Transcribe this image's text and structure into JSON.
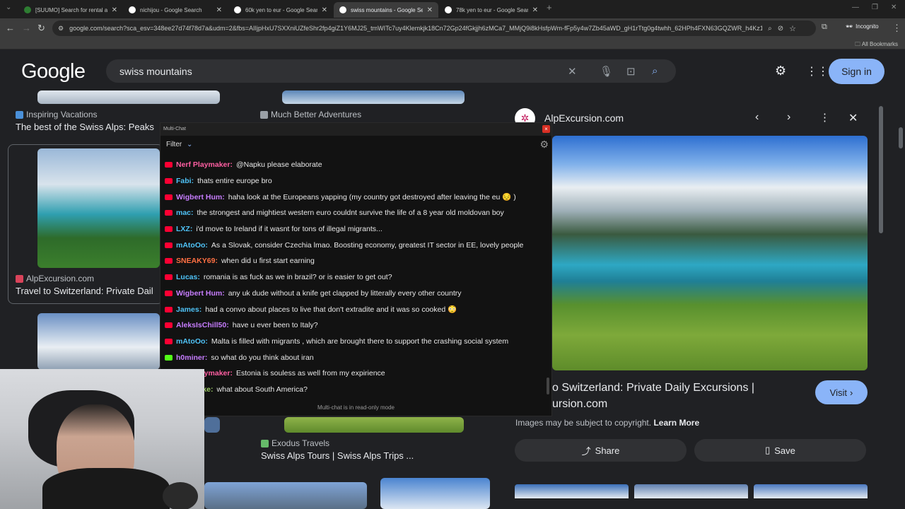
{
  "tabs": [
    {
      "title": "[SUUMO] Search for rental apa",
      "active": false
    },
    {
      "title": "nichijou - Google Search",
      "active": false
    },
    {
      "title": "60k yen to eur - Google Search",
      "active": false
    },
    {
      "title": "swiss mountains - Google Sear",
      "active": true
    },
    {
      "title": "78k yen to eur - Google Search",
      "active": false
    }
  ],
  "toolbar": {
    "url": "google.com/search?sca_esv=348ee27d74f78d7a&udm=2&fbs=AIIjpHxU7SXXniUZfeShr2fp4giZ1Y6MJ25_tmWITc7uy4Klemkjk18Cn72Gp24fGkjjh6zMCa7_MMjQ9i8kHsfpWm-fFp5y4w7Zb45aWD_gH1rTtg0g4twhh_62HPh4FXN63GQZWR_h4Kz1W9-IDHxqw...",
    "incognito_label": "Incognito",
    "all_bookmarks": "All Bookmarks"
  },
  "search": {
    "logo": "Google",
    "query": "swiss mountains",
    "sign_in": "Sign in"
  },
  "results": [
    {
      "source": "Inspiring Vacations",
      "title": "The best of the Swiss Alps: Peaks"
    },
    {
      "source": "Much Better Adventures",
      "title": ""
    },
    {
      "source": "AlpExcursion.com",
      "title": "Travel to Switzerland: Private Dail"
    },
    {
      "source": "Exodus Travels",
      "title": "Swiss Alps Tours | Swiss Alps Trips ..."
    }
  ],
  "panel": {
    "source": "AlpExcursion.com",
    "title_line1": "o Switzerland: Private Daily Excursions |",
    "title_line2": "ursion.com",
    "visit": "Visit",
    "copyright": "Images may be subject to copyright.",
    "learn_more": "Learn More",
    "share": "Share",
    "save": "Save"
  },
  "chat": {
    "title": "Multi-Chat",
    "filter": "Filter",
    "readonly": "Multi-chat is in read-only mode",
    "messages": [
      {
        "platform": "youtube",
        "user": "Nerf Playmaker:",
        "color": "#ff5fa2",
        "text": "@Napku please elaborate"
      },
      {
        "platform": "youtube",
        "user": "Fabi:",
        "color": "#4fc3f7",
        "text": "thats entire europe bro"
      },
      {
        "platform": "youtube",
        "user": "Wigbert Hum:",
        "color": "#c77dff",
        "text": "haha look at the Europeans yapping (my country got destroyed after leaving the eu 😔 )"
      },
      {
        "platform": "youtube",
        "user": "mac:",
        "color": "#4fc3f7",
        "text": "the strongest and mightiest western euro couldnt survive the life of a 8 year old moldovan boy"
      },
      {
        "platform": "youtube",
        "user": "LXZ:",
        "color": "#4fc3f7",
        "text": "i'd move to Ireland if it wasnt for tons of illegal migrants..."
      },
      {
        "platform": "youtube",
        "user": "mAtoOo:",
        "color": "#4fc3f7",
        "text": "As a Slovak, consider Czechia lmao. Boosting economy, greatest IT sector in EE, lovely people"
      },
      {
        "platform": "youtube",
        "user": "SNEAKY69:",
        "color": "#ff7043",
        "text": "when did u first start earning"
      },
      {
        "platform": "youtube",
        "user": "Lucas:",
        "color": "#4fc3f7",
        "text": "romania is as fuck as we in brazil? or is easier to get out?"
      },
      {
        "platform": "youtube",
        "user": "Wigbert Hum:",
        "color": "#c77dff",
        "text": "any uk dude without a knife get clapped by litterally every other country"
      },
      {
        "platform": "youtube",
        "user": "James:",
        "color": "#4fc3f7",
        "text": "had a convo about places to live that don't extradite and it was so cooked 😳"
      },
      {
        "platform": "youtube",
        "user": "AleksIsChill50:",
        "color": "#c77dff",
        "text": "have u ever been to Italy?"
      },
      {
        "platform": "youtube",
        "user": "mAtoOo:",
        "color": "#4fc3f7",
        "text": "Malta is filled with migrants , which are brought there to support the crashing social system"
      },
      {
        "platform": "kick",
        "user": "h0miner:",
        "color": "#c77dff",
        "text": "so what do you think about iran"
      },
      {
        "platform": "youtube",
        "user": "Nerf Playmaker:",
        "color": "#ff5fa2",
        "text": "Estonia is souless as well from my expirience"
      },
      {
        "platform": "youtube",
        "user": "Schnitzke:",
        "color": "#9ccc65",
        "text": "what about South America?"
      }
    ]
  },
  "colors": {
    "accent": "#8ab4f8",
    "background": "#202124"
  }
}
